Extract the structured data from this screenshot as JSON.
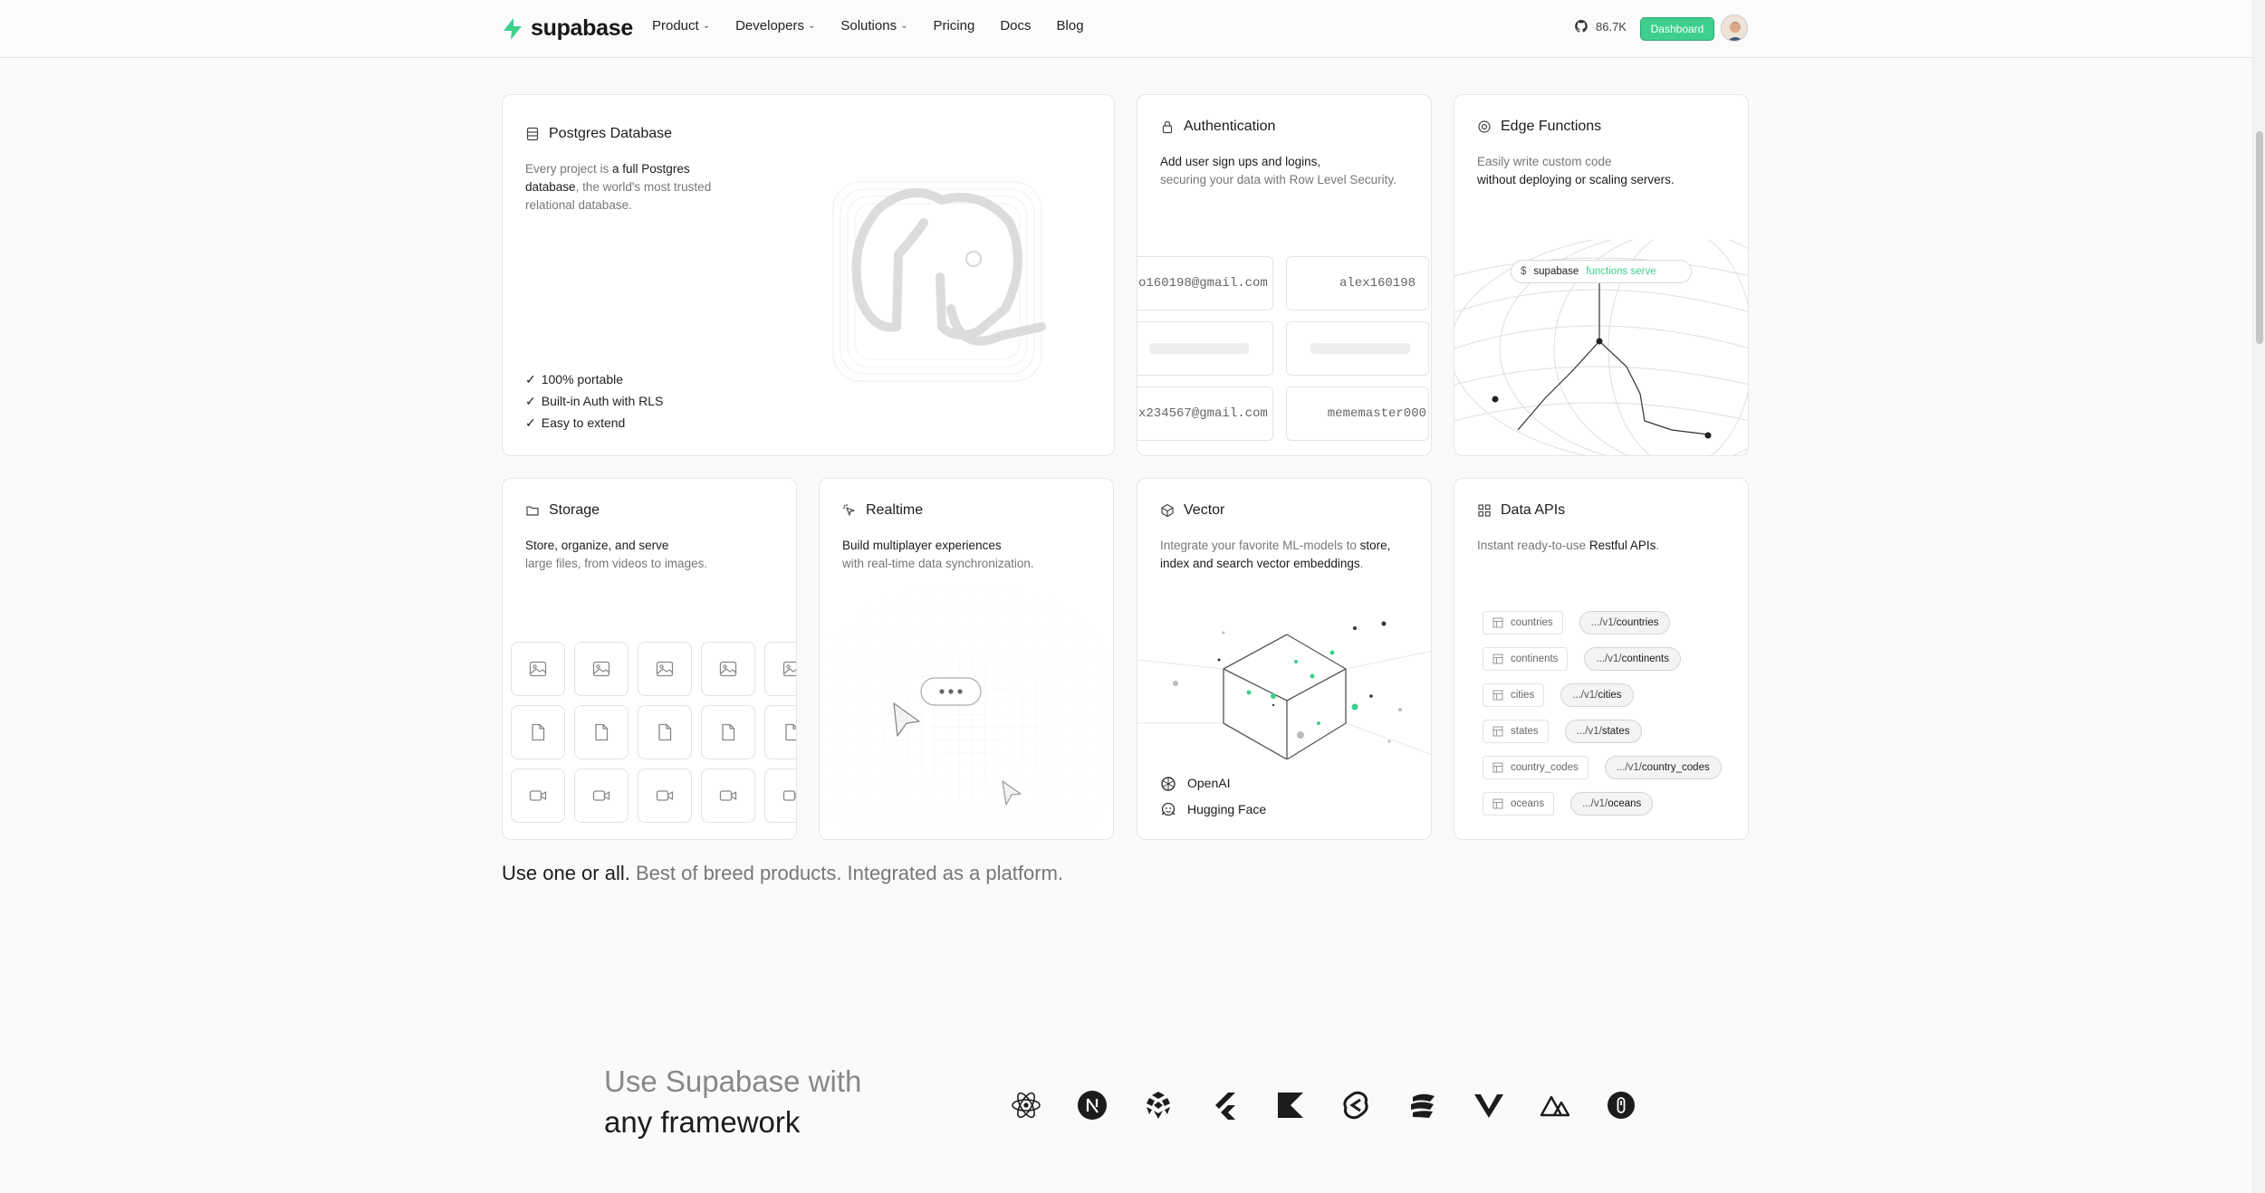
{
  "nav": {
    "brand": "supabase",
    "links": [
      {
        "label": "Product",
        "dropdown": true
      },
      {
        "label": "Developers",
        "dropdown": true
      },
      {
        "label": "Solutions",
        "dropdown": true
      },
      {
        "label": "Pricing",
        "dropdown": false
      },
      {
        "label": "Docs",
        "dropdown": false
      },
      {
        "label": "Blog",
        "dropdown": false
      }
    ],
    "github_stars": "86.7K",
    "dashboard_label": "Dashboard"
  },
  "colors": {
    "accent": "#3ecf8e",
    "border": "#e6e6e6",
    "muted": "#777777"
  },
  "postgres": {
    "title": "Postgres Database",
    "desc_1": "Every project is ",
    "desc_2": "a full Postgres",
    "desc_3": "database",
    "desc_4": ", the world's most trusted",
    "desc_5": "relational database.",
    "features": [
      "100% portable",
      "Built-in Auth with RLS",
      "Easy to extend"
    ]
  },
  "auth": {
    "title": "Authentication",
    "desc_1": "Add user sign ups and logins,",
    "desc_2": "securing your data with Row Level Security.",
    "cells": [
      "o160198@gmail.com",
      "alex160198",
      "x234567@gmail.com",
      "mememaster000"
    ]
  },
  "edge": {
    "title": "Edge Functions",
    "desc_1": "Easily write custom code",
    "desc_2": "without deploying or scaling servers.",
    "cmd_prefix": "$",
    "cmd_name": "supabase",
    "cmd_args": "functions serve"
  },
  "storage": {
    "title": "Storage",
    "desc_1": "Store, organize, and serve",
    "desc_2": "large files, from videos to images."
  },
  "realtime": {
    "title": "Realtime",
    "desc_1": "Build multiplayer experiences",
    "desc_2": "with real-time data synchronization."
  },
  "vector": {
    "title": "Vector",
    "desc_1": "Integrate your favorite ML-models to ",
    "desc_2": "store,",
    "desc_3": "index and search vector embeddings",
    "desc_4": ".",
    "providers": [
      "OpenAI",
      "Hugging Face"
    ]
  },
  "apis": {
    "title": "Data APIs",
    "desc_1": "Instant ready-to-use ",
    "desc_2": "Restful APIs",
    "desc_3": ".",
    "endpoint_prefix": ".../v1/",
    "rows": [
      {
        "table": "countries",
        "endpoint": "countries"
      },
      {
        "table": "continents",
        "endpoint": "continents"
      },
      {
        "table": "cities",
        "endpoint": "cities"
      },
      {
        "table": "states",
        "endpoint": "states"
      },
      {
        "table": "country_codes",
        "endpoint": "country_codes"
      },
      {
        "table": "oceans",
        "endpoint": "oceans"
      }
    ]
  },
  "tagline": {
    "strong": "Use one or all.",
    "rest": " Best of breed products. Integrated as a platform."
  },
  "frameworks": {
    "title_1": "Use Supabase with",
    "title_2": "any framework",
    "icons": [
      "react-icon",
      "nextjs-icon",
      "redwood-icon",
      "flutter-icon",
      "kotlin-icon",
      "svelte-icon",
      "solidjs-icon",
      "vue-icon",
      "nuxt-icon",
      "refine-icon"
    ]
  }
}
